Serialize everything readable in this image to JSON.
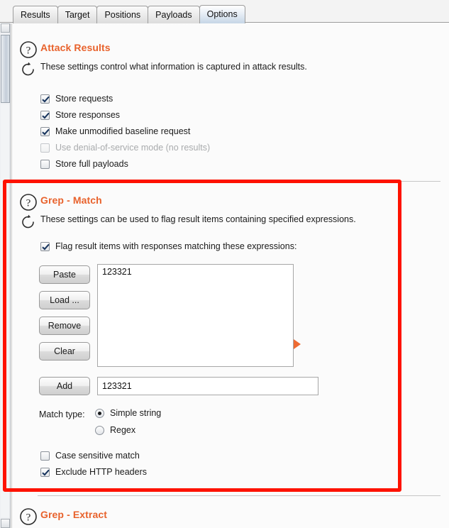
{
  "window": {
    "tabs": [
      {
        "label": "Results",
        "selected": false
      },
      {
        "label": "Target",
        "selected": false
      },
      {
        "label": "Positions",
        "selected": false
      },
      {
        "label": "Payloads",
        "selected": false
      },
      {
        "label": "Options",
        "selected": true
      }
    ]
  },
  "colors": {
    "heading_orange": "#e8622c",
    "marker_orange": "#ee6b33",
    "annotation_red": "#fe1200",
    "selected_tab_blue": "#c6d6e6"
  },
  "attack_results": {
    "title": "Attack Results",
    "description": "These settings control what information is captured in attack results.",
    "help_icon": "question-mark-circle-icon",
    "refresh_icon": "refresh-arrow-icon",
    "options": [
      {
        "label": "Store requests",
        "checked": true,
        "disabled": false
      },
      {
        "label": "Store responses",
        "checked": true,
        "disabled": false
      },
      {
        "label": "Make unmodified baseline request",
        "checked": true,
        "disabled": false
      },
      {
        "label": "Use denial-of-service mode (no results)",
        "checked": false,
        "disabled": true
      },
      {
        "label": "Store full payloads",
        "checked": false,
        "disabled": false
      }
    ]
  },
  "grep_match": {
    "title": "Grep - Match",
    "description": "These settings can be used to flag result items containing specified expressions.",
    "help_icon": "question-mark-circle-icon",
    "refresh_icon": "refresh-arrow-icon",
    "flag_checkbox": {
      "label": "Flag result items with responses matching these expressions:",
      "checked": true
    },
    "buttons": [
      {
        "label": "Paste"
      },
      {
        "label": "Load ..."
      },
      {
        "label": "Remove"
      },
      {
        "label": "Clear"
      }
    ],
    "add_button": {
      "label": "Add"
    },
    "expression_list": [
      "123321"
    ],
    "add_field": {
      "value": "123321",
      "placeholder": ""
    },
    "marker_icon": "right-triangle-marker-icon",
    "match_type": {
      "label": "Match type:",
      "options": [
        {
          "label": "Simple string",
          "selected": true
        },
        {
          "label": "Regex",
          "selected": false
        }
      ]
    },
    "extra_options": [
      {
        "label": "Case sensitive match",
        "checked": false
      },
      {
        "label": "Exclude HTTP headers",
        "checked": true
      }
    ]
  },
  "grep_extract": {
    "title": "Grep - Extract",
    "help_icon": "question-mark-circle-icon"
  },
  "scrollbar": {
    "up_arrow_icon": "scroll-up-arrow-icon",
    "down_arrow_icon": "scroll-down-arrow-icon"
  }
}
